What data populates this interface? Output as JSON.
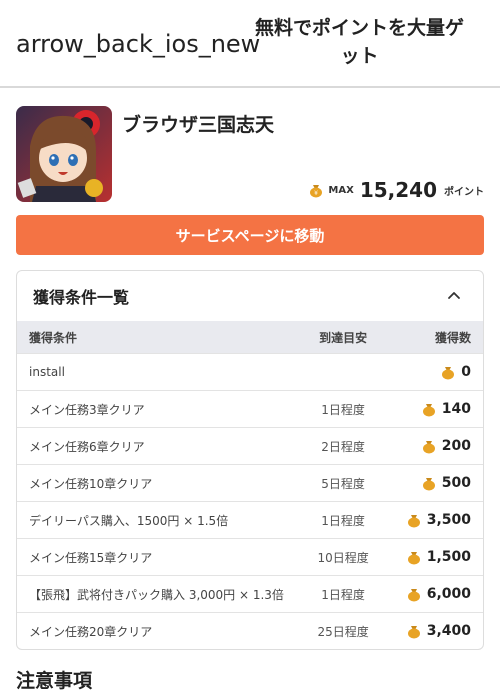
{
  "header": {
    "back_icon_text": "arrow_back_ios_new",
    "title": "無料でポイントを大量ゲット"
  },
  "app": {
    "name": "ブラウザ三国志天",
    "icon": "game-character-icon",
    "max_label": "MAX",
    "max_points": "15,240",
    "points_unit": "ポイント"
  },
  "service_button": {
    "label": "サービスページに移動"
  },
  "conditions": {
    "title": "獲得条件一覧",
    "columns": [
      "獲得条件",
      "到達目安",
      "獲得数"
    ],
    "rows": [
      {
        "condition": "install",
        "estimate": "",
        "reward": "0"
      },
      {
        "condition": "メイン任務3章クリア",
        "estimate": "1日程度",
        "reward": "140"
      },
      {
        "condition": "メイン任務6章クリア",
        "estimate": "2日程度",
        "reward": "200"
      },
      {
        "condition": "メイン任務10章クリア",
        "estimate": "5日程度",
        "reward": "500"
      },
      {
        "condition": "デイリーパス購入、1500円 × 1.5倍",
        "estimate": "1日程度",
        "reward": "3,500"
      },
      {
        "condition": "メイン任務15章クリア",
        "estimate": "10日程度",
        "reward": "1,500"
      },
      {
        "condition": "【張飛】武将付きパック購入 3,000円 × 1.3倍",
        "estimate": "1日程度",
        "reward": "6,000"
      },
      {
        "condition": "メイン任務20章クリア",
        "estimate": "25日程度",
        "reward": "3,400"
      }
    ]
  },
  "notes": {
    "title": "注意事項"
  },
  "colors": {
    "accent": "#f47344",
    "table_header": "#e9eaef",
    "coin": "#e8a325"
  }
}
